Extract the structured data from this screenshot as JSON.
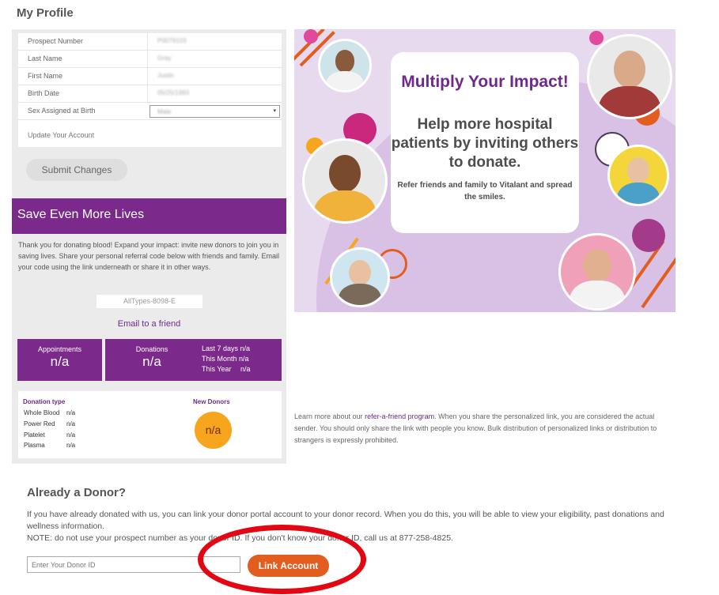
{
  "page": {
    "title": "My Profile"
  },
  "profile": {
    "rows": [
      {
        "label": "Prospect Number",
        "value": "P0079103"
      },
      {
        "label": "Last Name",
        "value": "Gray"
      },
      {
        "label": "First Name",
        "value": "Justin"
      },
      {
        "label": "Birth Date",
        "value": "05/25/1993"
      },
      {
        "label": "Sex Assigned at Birth",
        "value": "Male"
      }
    ],
    "update_label": "Update Your Account",
    "submit_label": "Submit Changes"
  },
  "referral": {
    "banner": "Save Even More Lives",
    "description": "Thank you for donating blood! Expand your impact: invite new donors to join you in saving lives. Share your personal referral code below with friends and family. Email your code using the link underneath or share it in other ways.",
    "code": "AllTypes-8098-E",
    "email_link": "Email to a friend"
  },
  "stats": {
    "appointments_label": "Appointments",
    "appointments_value": "n/a",
    "donations_label": "Donations",
    "donations_value": "n/a",
    "last7": "Last 7 days n/a",
    "this_month": "This Month n/a",
    "this_year": "This Year",
    "this_year_value": "n/a"
  },
  "breakdown": {
    "title": "Donation type",
    "rows": [
      {
        "label": "Whole Blood",
        "value": "n/a"
      },
      {
        "label": "Power Red",
        "value": "n/a"
      },
      {
        "label": "Platelet",
        "value": "n/a"
      },
      {
        "label": "Plasma",
        "value": "n/a"
      }
    ],
    "new_donors_title": "New Donors",
    "new_donors_value": "n/a"
  },
  "promo": {
    "headline": "Multiply Your Impact!",
    "subheadline": "Help more hospital patients by inviting others to donate.",
    "body": "Refer friends and family to Vitalant and spread the smiles.",
    "colors": {
      "purple": "#6e2a8a",
      "orange": "#e35d1f",
      "lavender": "#d9c1e6"
    }
  },
  "learn_more": {
    "prefix": "Learn more about our",
    "link": "refer-a-friend program",
    "suffix": ". When you share the personalized link, you are considered the actual sender. You should only share the link with people you know. Bulk distribution of personalized links or distribution to strangers is expressly prohibited."
  },
  "donor": {
    "title": "Already a Donor?",
    "paragraph": "If you have already donated with us, you can link your donor portal account to your donor record. When you do this, you will be able to view your eligibility, past donations and wellness information.",
    "note": "NOTE: do not use your prospect number as your donor ID. If you don't know your donor ID, call us at 877-258-4825.",
    "input_placeholder": "Enter Your Donor ID",
    "button": "Link Account",
    "highlight_color": "#e30613"
  }
}
